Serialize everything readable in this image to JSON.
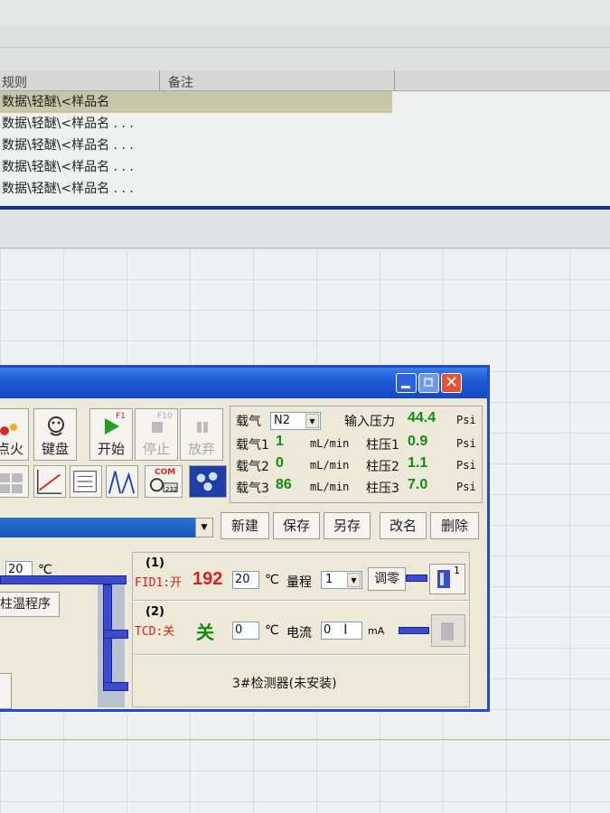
{
  "list": {
    "col1_header": "规则",
    "col2_header": "备注",
    "rows": [
      "数据\\轻醚\\<样品名",
      "数据\\轻醚\\<样品名 . . .",
      "数据\\轻醚\\<样品名 . . .",
      "数据\\轻醚\\<样品名 . . .",
      "数据\\轻醚\\<样品名 . . ."
    ]
  },
  "toolbar": {
    "fire_label": "点火",
    "keypad_label": "键盘",
    "start_label": "开始",
    "start_key": "F1",
    "stop_label": "停止",
    "stop_key": "F10",
    "abandon_label": "放弃",
    "com_label": "COM",
    "com_num": "232"
  },
  "gas": {
    "carrier_label": "载气",
    "carrier_select": "N2",
    "input_pressure_label": "输入压力",
    "input_pressure_value": "44.4",
    "unit_psi": "Psi",
    "unit_flow": "mL/min",
    "rows": [
      {
        "label": "载气1",
        "flow": "1",
        "col_label": "柱压1",
        "col_value": "0.9"
      },
      {
        "label": "载气2",
        "flow": "0",
        "col_label": "柱压2",
        "col_value": "1.1"
      },
      {
        "label": "载气3",
        "flow": "86",
        "col_label": "柱压3",
        "col_value": "7.0"
      }
    ]
  },
  "method": {
    "new_label": "新建",
    "save_label": "保存",
    "save_as_label": "另存",
    "rename_label": "改名",
    "delete_label": "删除"
  },
  "oven": {
    "temp_value": "20",
    "temp_unit": "℃",
    "program_label": "柱温程序"
  },
  "detectors": {
    "d1_index": "(1)",
    "d1_name": "FID1:开",
    "d1_actual": "192",
    "d1_set": "20",
    "temp_unit": "℃",
    "range_label": "量程",
    "range_value": "1",
    "zero_label": "调零",
    "d1_badge": "1",
    "d2_index": "(2)",
    "d2_name": "TCD:关",
    "d2_state": "关",
    "d2_set": "0",
    "current_label": "电流",
    "current_value": "0",
    "current_unit": "mA",
    "d3_label": "3#检测器(未安装)"
  },
  "colors": {
    "title_blue": "#1d58d6",
    "value_green": "#118c11",
    "value_red": "#d42020",
    "pipe_blue": "#3a4bd0"
  }
}
